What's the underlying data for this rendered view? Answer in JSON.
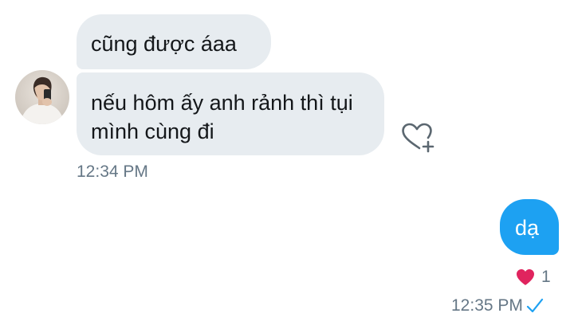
{
  "messages": {
    "incoming": [
      {
        "text": "cũng được áaa"
      },
      {
        "text": "nếu hôm ấy anh rảnh thì tụi mình cùng đi"
      }
    ],
    "incoming_time": "12:34 PM",
    "outgoing": [
      {
        "text": "dạ"
      }
    ],
    "outgoing_reaction": {
      "icon": "heart-icon",
      "count": "1",
      "color": "#e0245e"
    },
    "outgoing_time": "12:35 PM",
    "outgoing_status_icon": "checkmark-icon"
  },
  "colors": {
    "incoming_bubble": "#e7ecf0",
    "outgoing_bubble": "#1da1f2",
    "timestamp": "#657786",
    "check": "#1da1f2"
  },
  "icons": {
    "like_action": "heart-plus-icon",
    "avatar": "avatar"
  }
}
